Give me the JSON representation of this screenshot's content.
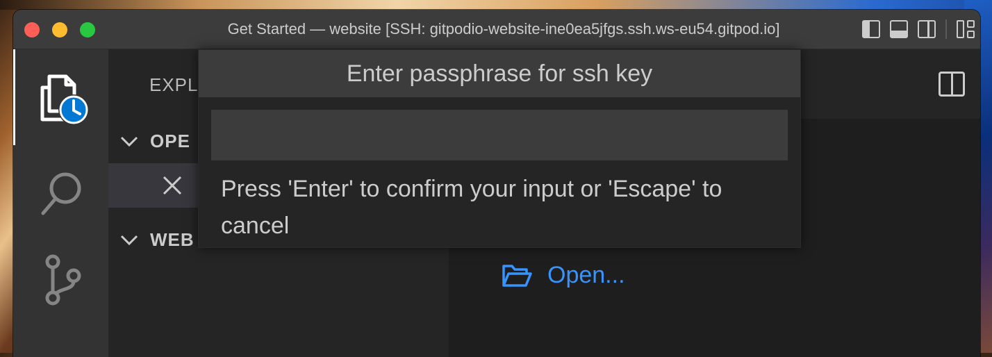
{
  "window": {
    "title": "Get Started — website [SSH: gitpodio-website-ine0ea5jfgs.ssh.ws-eu54.gitpod.io]"
  },
  "activity_bar": {
    "items": [
      {
        "name": "explorer",
        "icon": "files-icon",
        "active": true
      },
      {
        "name": "search",
        "icon": "search-icon"
      },
      {
        "name": "source-control",
        "icon": "source-control-icon"
      }
    ]
  },
  "sidebar": {
    "header": "EXPL",
    "sections": [
      {
        "label": "OPE"
      },
      {
        "label": "WEB"
      }
    ]
  },
  "editor": {
    "open_link_label": "Open..."
  },
  "quick_input": {
    "title": "Enter passphrase for ssh key",
    "value": "",
    "message": "Press 'Enter' to confirm your input or 'Escape' to cancel"
  },
  "colors": {
    "accent_blue": "#3794ff",
    "badge_blue": "#0078d4",
    "titlebar": "#3c3c3c",
    "activity_bar": "#333333",
    "sidebar": "#252526",
    "editor": "#1e1e1e"
  }
}
